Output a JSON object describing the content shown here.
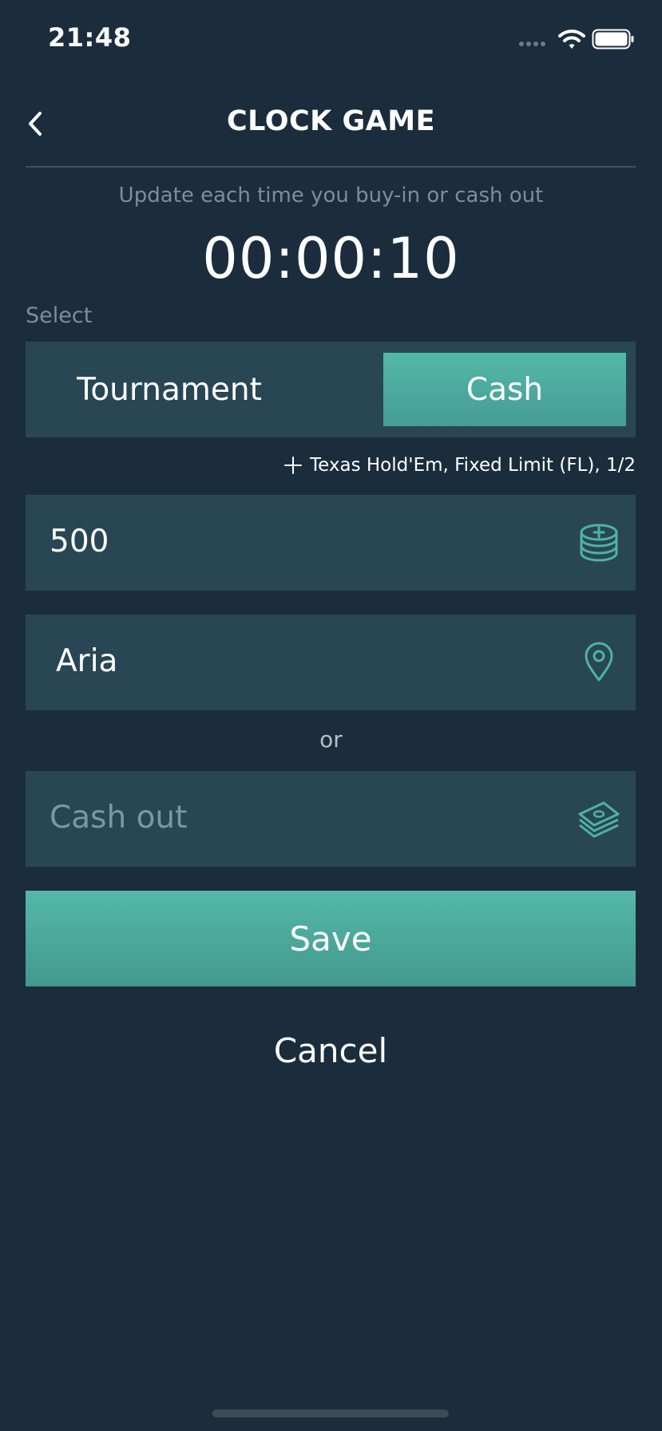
{
  "status_bar": {
    "time": "21:48"
  },
  "header": {
    "title": "CLOCK GAME",
    "back_icon": "chevron-left-icon"
  },
  "hint": "Update each time you buy-in or cash out",
  "timer": "00:00:10",
  "select_label": "Select",
  "game_type": {
    "options": [
      "Tournament",
      "Cash"
    ],
    "selected": "Cash"
  },
  "game_details": {
    "icon": "plus-icon",
    "label": "Texas Hold'Em, Fixed Limit (FL), 1/2"
  },
  "buy_in": {
    "value": "500",
    "icon": "chips-add-icon"
  },
  "location": {
    "value": "Aria",
    "icon": "map-pin-icon"
  },
  "or_text": "or",
  "cash_out": {
    "placeholder": "Cash out",
    "value": "",
    "icon": "cash-stack-icon"
  },
  "actions": {
    "save_label": "Save",
    "cancel_label": "Cancel"
  },
  "colors": {
    "background": "#1b2d3c",
    "field": "#294655",
    "accent": "#53b8a8",
    "muted_text": "#7d8d99"
  }
}
